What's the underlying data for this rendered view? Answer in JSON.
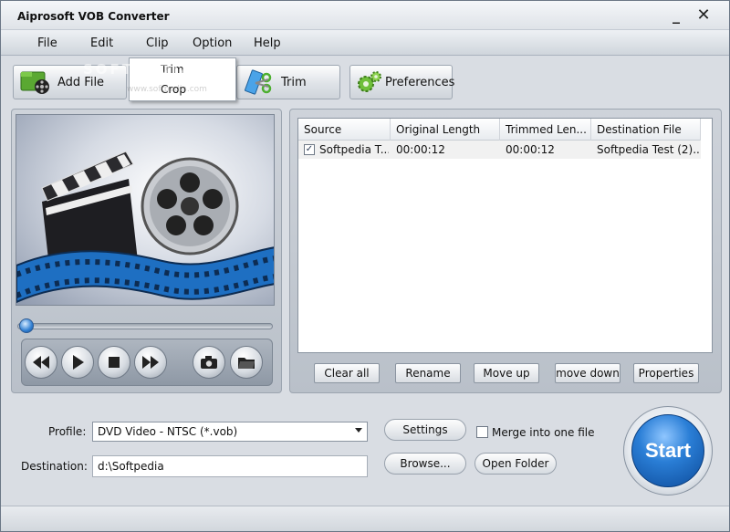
{
  "window": {
    "title": "Aiprosoft VOB Converter",
    "minimize": "_",
    "close": "✕"
  },
  "menu": [
    "File",
    "Edit",
    "Clip",
    "Option",
    "Help"
  ],
  "clip_menu": [
    "Trim",
    "Crop"
  ],
  "toolbar": {
    "add_file": "Add File",
    "trim": "Trim",
    "preferences": "Preferences"
  },
  "watermark": "SOFTPEDIA",
  "watermark_url": "www.softpedia.com",
  "file_list": {
    "columns": [
      "Source",
      "Original Length",
      "Trimmed Len...",
      "Destination File"
    ],
    "rows": [
      {
        "checked": true,
        "source": "Softpedia T...",
        "original": "00:00:12",
        "trimmed": "00:00:12",
        "destination": "Softpedia Test (2)..."
      }
    ]
  },
  "list_buttons": {
    "clear_all": "Clear all",
    "rename": "Rename",
    "move_up": "Move up",
    "move_down": "move down",
    "properties": "Properties"
  },
  "profile": {
    "label": "Profile:",
    "value": "DVD Video - NTSC (*.vob)"
  },
  "destination": {
    "label": "Destination:",
    "value": "d:\\Softpedia"
  },
  "buttons": {
    "settings": "Settings",
    "browse": "Browse...",
    "open_folder": "Open Folder",
    "start": "Start"
  },
  "merge": {
    "label": "Merge into one file",
    "checked": false
  },
  "colors": {
    "accent": "#2a7ed6",
    "window_bg": "#d9dde3",
    "panel": "#c3c9d1"
  }
}
